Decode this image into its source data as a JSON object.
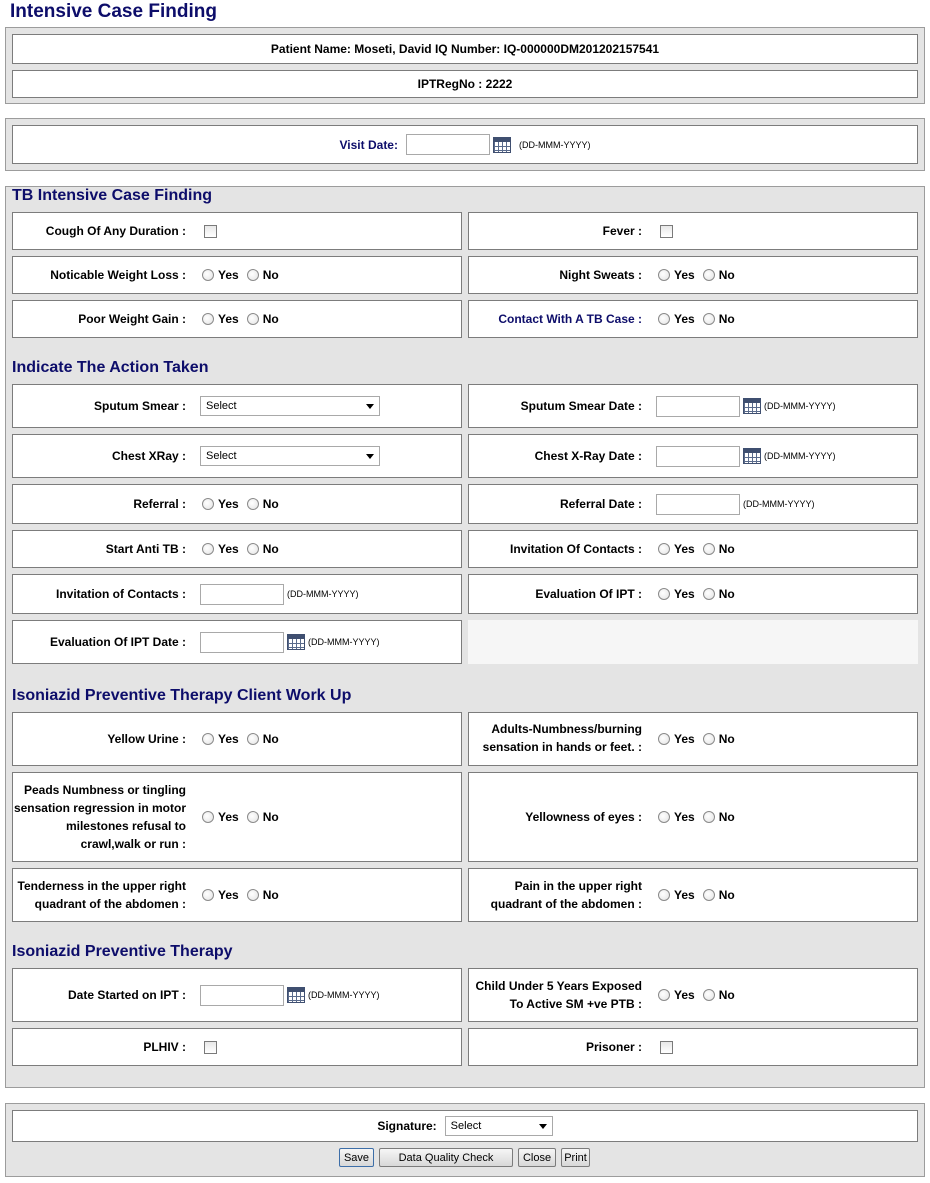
{
  "page": {
    "title": "Intensive Case Finding"
  },
  "header": {
    "patient_line": "Patient Name: Moseti, David   IQ Number: IQ-000000DM201202157541",
    "ipt_reg": "IPTRegNo : 2222"
  },
  "visit": {
    "label": "Visit Date:",
    "value": "",
    "format": "(DD-MMM-YYYY)"
  },
  "common": {
    "yes": "Yes",
    "no": "No",
    "select": "Select",
    "date_format": "(DD-MMM-YYYY)"
  },
  "tb": {
    "title": "TB Intensive Case Finding",
    "cough": "Cough Of Any Duration :",
    "fever": "Fever :",
    "weight_loss": "Noticable Weight Loss :",
    "night_sweats": "Night Sweats :",
    "poor_gain": "Poor Weight Gain :",
    "contact": "Contact With A TB Case :"
  },
  "action": {
    "title": "Indicate The Action Taken",
    "sputum": "Sputum Smear :",
    "sputum_date": "Sputum Smear Date :",
    "xray": "Chest XRay :",
    "xray_date": "Chest X-Ray Date :",
    "referral": "Referral :",
    "referral_date": "Referral Date :",
    "anti_tb": "Start Anti TB :",
    "invitation": "Invitation Of Contacts :",
    "invitation_date": "Invitation of Contacts :",
    "eval_ipt": "Evaluation Of IPT :",
    "eval_ipt_date": "Evaluation Of IPT Date :"
  },
  "workup": {
    "title": "Isoniazid Preventive Therapy Client Work Up",
    "yellow_urine": "Yellow Urine :",
    "adults_numb_1": "Adults-Numbness/burning",
    "adults_numb_2": "sensation in hands or feet. :",
    "peads_1": "Peads Numbness or tingling",
    "peads_2": "sensation regression in motor",
    "peads_3": "milestones refusal to",
    "peads_4": "crawl,walk or run :",
    "yellow_eyes": "Yellowness of eyes :",
    "tender_1": "Tenderness in the upper right",
    "tender_2": "quadrant of the abdomen :",
    "pain_1": "Pain in the upper right",
    "pain_2": "quadrant of the abdomen :"
  },
  "ipt": {
    "title": "Isoniazid Preventive Therapy",
    "date_started": "Date Started on IPT :",
    "child_1": "Child Under 5 Years Exposed",
    "child_2": "To Active SM +ve PTB :",
    "plhiv": "PLHIV :",
    "prisoner": "Prisoner :"
  },
  "footer": {
    "signature": "Signature:",
    "save": "Save",
    "dqc": "Data Quality Check",
    "close": "Close",
    "print": "Print"
  }
}
